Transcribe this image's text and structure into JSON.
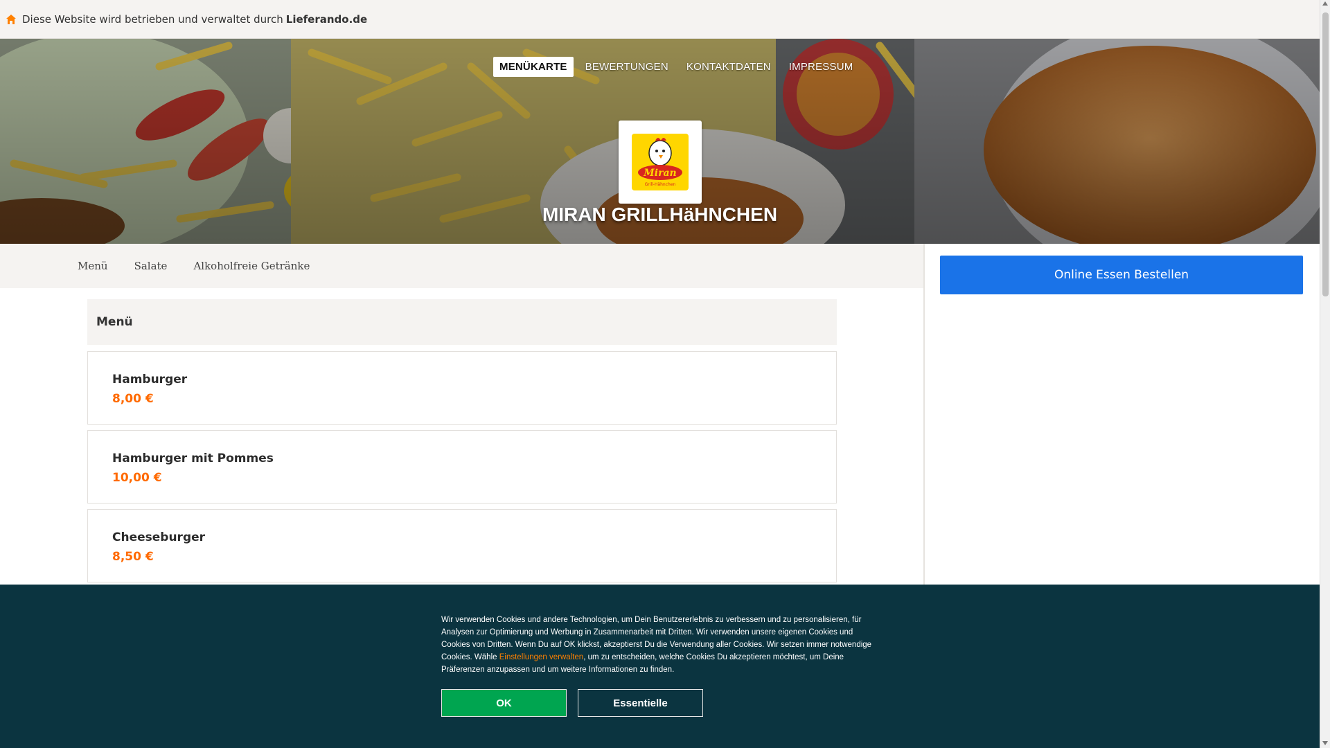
{
  "topbar": {
    "notice": "Diese Website wird betrieben und verwaltet durch",
    "brand": "Lieferando.de",
    "icon": "home-icon"
  },
  "nav": [
    {
      "label": "MENÜKARTE",
      "active": true
    },
    {
      "label": "BEWERTUNGEN",
      "active": false
    },
    {
      "label": "KONTAKTDATEN",
      "active": false
    },
    {
      "label": "IMPRESSUM",
      "active": false
    }
  ],
  "restaurant": {
    "name": "MIRAN GRILLHäHNCHEN",
    "logo_text": "Miran",
    "logo_subtext": "Grill-Hähnchen"
  },
  "categories": [
    "Menü",
    "Salate",
    "Alkoholfreie Getränke"
  ],
  "sidebar": {
    "order_button": "Online Essen Bestellen"
  },
  "section": {
    "title": "Menü"
  },
  "items": [
    {
      "name": "Hamburger",
      "price": "8,00 €"
    },
    {
      "name": "Hamburger mit Pommes",
      "price": "10,00 €"
    },
    {
      "name": "Cheeseburger",
      "price": "8,50 €"
    }
  ],
  "cookie": {
    "text_before": "Wir verwenden Cookies und andere Technologien, um Dein Benutzererlebnis zu verbessern und zu personalisieren, für Analysen zur Optimierung und Werbung in Zusammenarbeit mit Dritten. Wir verwenden unsere eigenen Cookies und Cookies von Dritten. Wenn Du auf OK klickst, akzeptierst Du die Verwendung aller Cookies. Wir setzen immer notwendige Cookies. Wähle ",
    "link": "Einstellungen verwalten",
    "text_after": ", um zu entscheiden, welche Cookies Du akzeptieren möchtest, um Deine Präferenzen anzupassen und um weitere Informationen zu finden.",
    "ok": "OK",
    "essential": "Essentielle"
  },
  "colors": {
    "accent_orange": "#ff6a00",
    "order_blue": "#1a73e8",
    "cookie_bg": "#0b3440",
    "ok_green": "#00a550"
  }
}
